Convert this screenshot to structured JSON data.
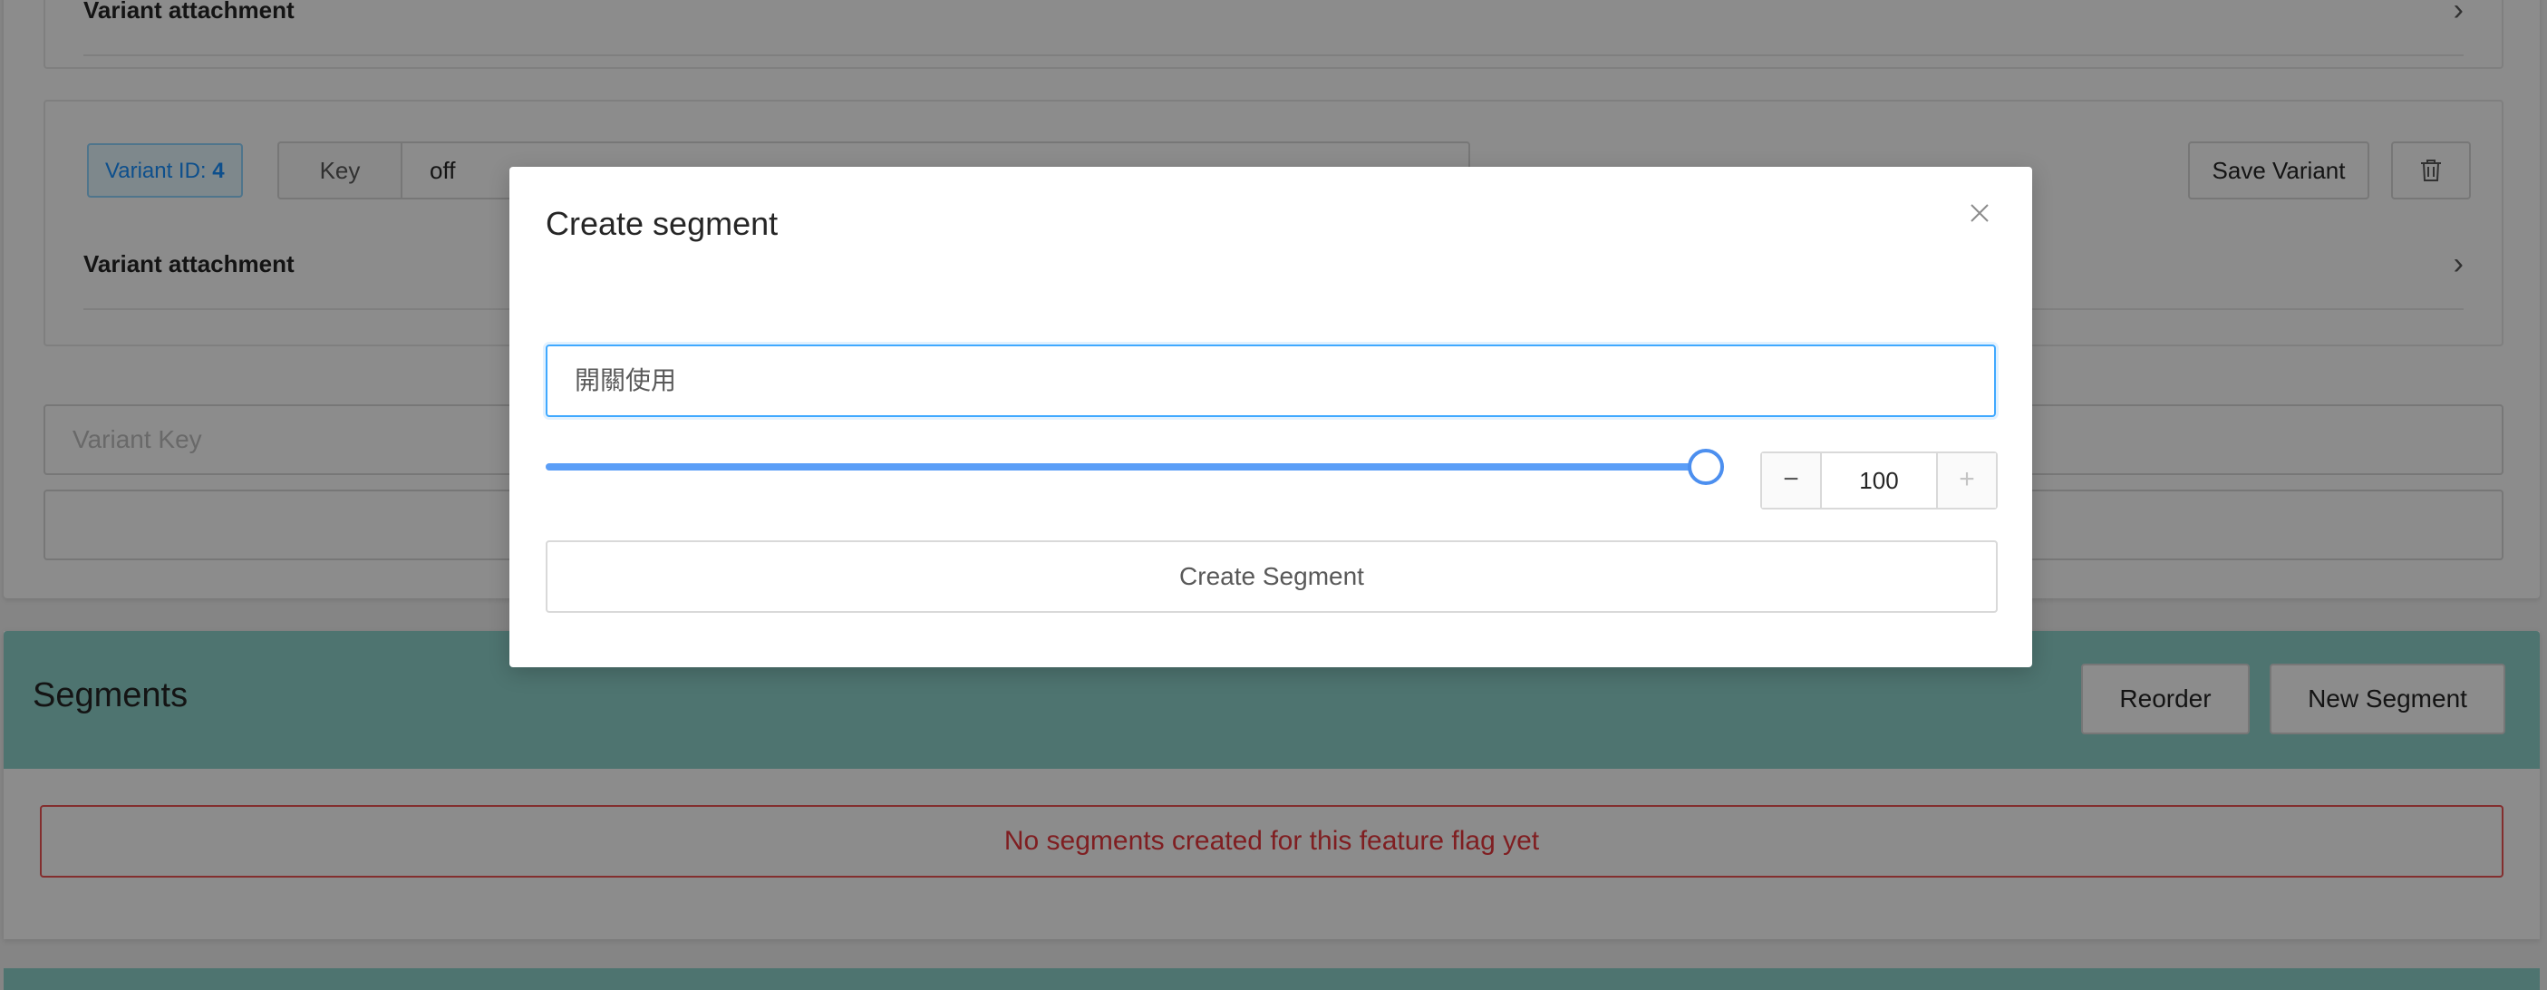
{
  "variants": {
    "first_attachment_label": "Variant attachment",
    "id_label": "Variant ID:",
    "id_value": "4",
    "key_addon": "Key",
    "key_value": "off",
    "save_label": "Save Variant",
    "attachment_label": "Variant attachment",
    "new_key_placeholder": "Variant Key"
  },
  "segments": {
    "title": "Segments",
    "reorder_label": "Reorder",
    "new_segment_label": "New Segment",
    "empty_message": "No segments created for this feature flag yet"
  },
  "modal": {
    "title": "Create segment",
    "description_value": "開關使用",
    "rollout_percent": 100,
    "rollout_display": "100",
    "minus_symbol": "−",
    "plus_symbol": "+",
    "create_label": "Create Segment"
  },
  "colors": {
    "primary": "#1890ff",
    "segments_header": "#8fd3cd",
    "error": "#e8383d"
  }
}
